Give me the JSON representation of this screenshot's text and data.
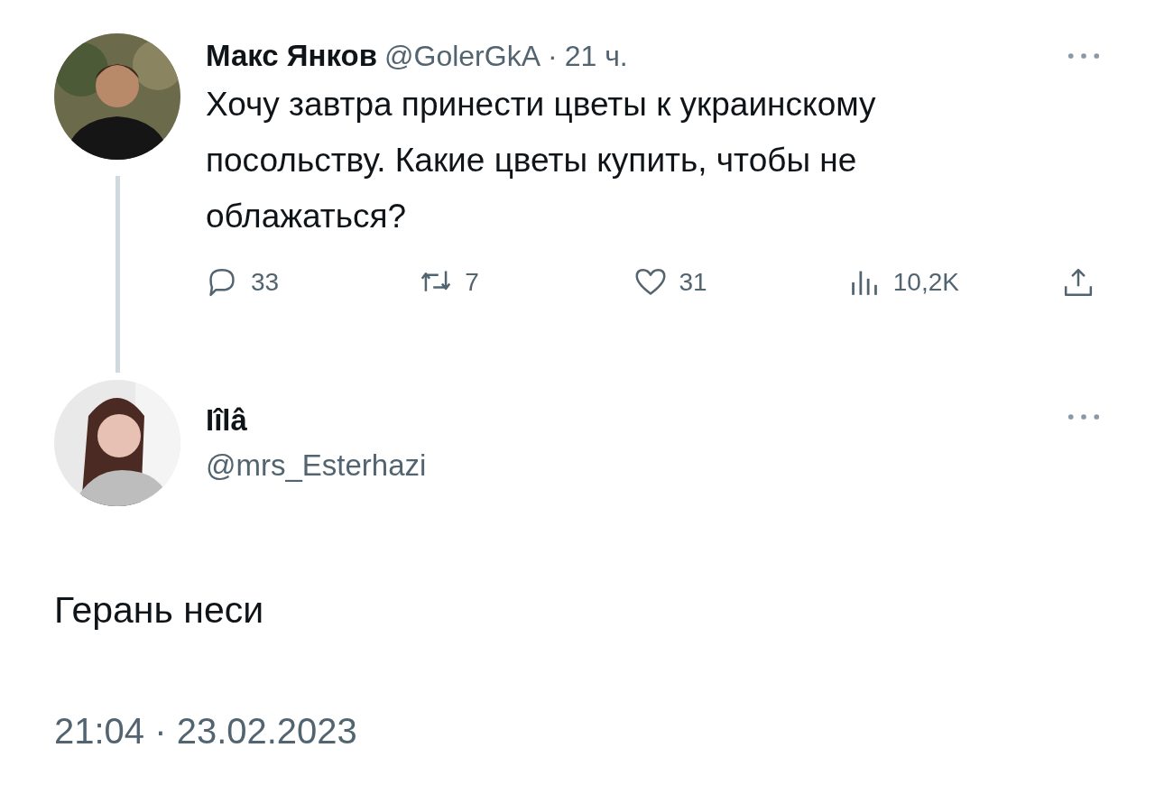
{
  "tweet": {
    "author": {
      "name": "Макс Янков",
      "handle": "@GolerGkA",
      "separator": "·",
      "time": "21 ч."
    },
    "text": "Хочу завтра принести цветы к украинскому посольству. Какие цветы купить, чтобы не облажаться?",
    "actions": [
      {
        "kind": "reply",
        "count": "33"
      },
      {
        "kind": "retweet",
        "count": "7"
      },
      {
        "kind": "like",
        "count": "31"
      },
      {
        "kind": "views",
        "count": "10,2K"
      },
      {
        "kind": "share"
      }
    ]
  },
  "reply": {
    "author": {
      "name": "Iîlâ",
      "handle": "@mrs_Esterhazi"
    },
    "text": "Герань неси",
    "timestamp": "21:04 · 23.02.2023"
  }
}
